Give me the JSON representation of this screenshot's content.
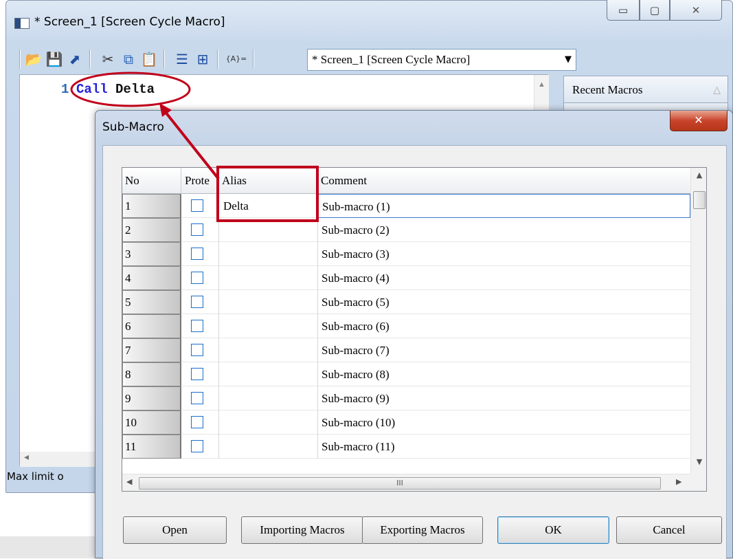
{
  "window": {
    "title": "* Screen_1 [Screen Cycle Macro]",
    "min_glyph": "▭",
    "max_glyph": "▢",
    "close_glyph": "✕"
  },
  "toolbar": {
    "icons": [
      "open-folder-icon",
      "save-icon",
      "export-icon",
      "cut-icon",
      "copy-icon",
      "paste-icon",
      "list-icon",
      "insert-table-icon",
      "alias-icon"
    ],
    "alias_label": "{A}=",
    "combo_value": "* Screen_1 [Screen Cycle Macro]"
  },
  "editor": {
    "line_number": "1",
    "code_keyword": "Call",
    "code_arg": "Delta"
  },
  "status": {
    "text": "Max limit o"
  },
  "recent": {
    "title": "Recent Macros"
  },
  "dialog": {
    "title": "Sub-Macro",
    "close_glyph": "✕",
    "columns": [
      "No",
      "Prote",
      "Alias",
      "Comment"
    ],
    "rows": [
      {
        "no": "1",
        "alias": "Delta",
        "comment": "Sub-macro (1)"
      },
      {
        "no": "2",
        "alias": "",
        "comment": "Sub-macro (2)"
      },
      {
        "no": "3",
        "alias": "",
        "comment": "Sub-macro (3)"
      },
      {
        "no": "4",
        "alias": "",
        "comment": "Sub-macro (4)"
      },
      {
        "no": "5",
        "alias": "",
        "comment": "Sub-macro (5)"
      },
      {
        "no": "6",
        "alias": "",
        "comment": "Sub-macro (6)"
      },
      {
        "no": "7",
        "alias": "",
        "comment": "Sub-macro (7)"
      },
      {
        "no": "8",
        "alias": "",
        "comment": "Sub-macro (8)"
      },
      {
        "no": "9",
        "alias": "",
        "comment": "Sub-macro (9)"
      },
      {
        "no": "10",
        "alias": "",
        "comment": "Sub-macro (10)"
      },
      {
        "no": "11",
        "alias": "",
        "comment": "Sub-macro (11)"
      }
    ],
    "hscroll_grip": "III",
    "buttons": {
      "open": "Open",
      "importing": "Importing Macros",
      "exporting": "Exporting Macros",
      "ok": "OK",
      "cancel": "Cancel"
    }
  },
  "colors": {
    "annotation_red": "#c0001a",
    "keyword_blue": "#2323d8",
    "checkbox_blue": "#1b6ec9"
  }
}
